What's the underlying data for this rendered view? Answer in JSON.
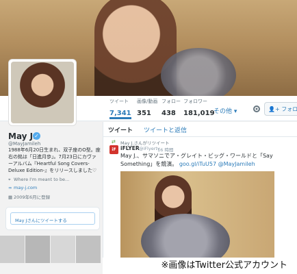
{
  "profile": {
    "name": "May J.",
    "handle": "@MayJamileh",
    "bio": "1988年6月20日生まれ、双子座のO型。座右の銘は「日進月歩」。7月23日にカヴァーアルバム『Heartful Song Covers-Deluxe Edition-』をリリースしました♡",
    "location": "Where I'm meant to be...",
    "website": "may-j.com",
    "joined": "2009年6月に登録",
    "verified_icon": "verified-badge-icon"
  },
  "nav": {
    "stats": [
      {
        "label": "ツイート",
        "value": "7,341"
      },
      {
        "label": "画像/動画",
        "value": "351"
      },
      {
        "label": "フォロー",
        "value": "438"
      },
      {
        "label": "フォロワー",
        "value": "181,019"
      }
    ],
    "more": "その他 ▾",
    "follow_label": "フォロー"
  },
  "tabs": {
    "tweets": "ツイート",
    "tweets_replies": "ツイートと返信"
  },
  "sidebar": {
    "tweet_to": "May Jさんにツイートする"
  },
  "tweet": {
    "retweet_line": "May J.さんがリツイート",
    "author": "iFLYER",
    "author_handle": "@iFlyertv",
    "time": "16 時間",
    "text": "May J.、サマソニでア・グレイト・ビッグ・ワールドと「Say Something」を競演。",
    "link": "goo.gl/iTuU57",
    "mention": "@MayJamileh",
    "avatar_letters": "iF"
  },
  "caption": "※画像はTwitter公式アカウント",
  "colors": {
    "accent": "#2b7bb9",
    "verified": "#55acee",
    "retweet": "#5cab3f"
  }
}
